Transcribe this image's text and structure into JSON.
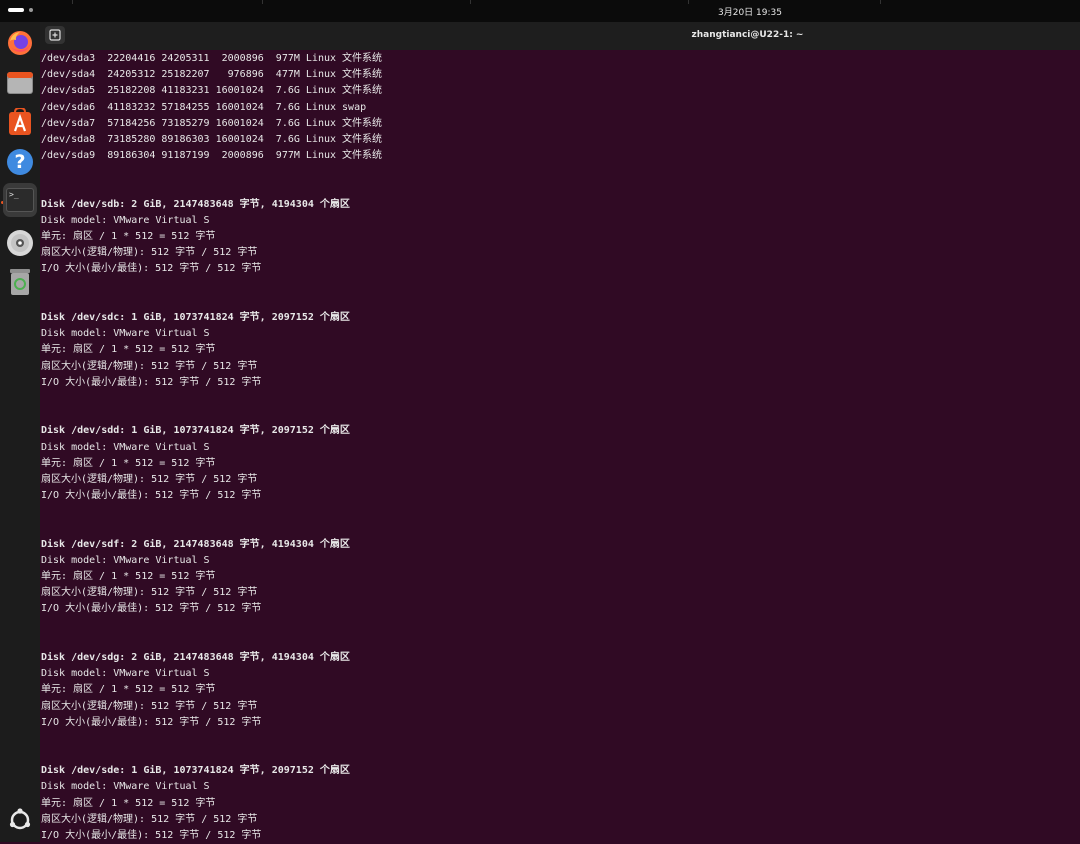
{
  "topbar": {
    "clock": "3月20日 19:35"
  },
  "dock": {
    "items": [
      {
        "name": "firefox-icon"
      },
      {
        "name": "files-icon"
      },
      {
        "name": "app-center-icon"
      },
      {
        "name": "help-icon"
      },
      {
        "name": "terminal-icon"
      },
      {
        "name": "disc-icon"
      },
      {
        "name": "trash-icon"
      },
      {
        "name": "show-apps-icon"
      }
    ],
    "terminal_glyph": ">_",
    "help_glyph": "?"
  },
  "terminal": {
    "title": "zhangtianci@U22-1: ~",
    "lines": [
      {
        "text": "/dev/sda3  22204416 24205311  2000896  977M Linux 文件系统",
        "bold": false
      },
      {
        "text": "/dev/sda4  24205312 25182207   976896  477M Linux 文件系统",
        "bold": false
      },
      {
        "text": "/dev/sda5  25182208 41183231 16001024  7.6G Linux 文件系统",
        "bold": false
      },
      {
        "text": "/dev/sda6  41183232 57184255 16001024  7.6G Linux swap",
        "bold": false
      },
      {
        "text": "/dev/sda7  57184256 73185279 16001024  7.6G Linux 文件系统",
        "bold": false
      },
      {
        "text": "/dev/sda8  73185280 89186303 16001024  7.6G Linux 文件系统",
        "bold": false
      },
      {
        "text": "/dev/sda9  89186304 91187199  2000896  977M Linux 文件系统",
        "bold": false
      },
      {
        "text": "",
        "bold": false
      },
      {
        "text": "",
        "bold": false
      },
      {
        "text": "Disk /dev/sdb: 2 GiB, 2147483648 字节, 4194304 个扇区",
        "bold": true
      },
      {
        "text": "Disk model: VMware Virtual S",
        "bold": false
      },
      {
        "text": "单元: 扇区 / 1 * 512 = 512 字节",
        "bold": false
      },
      {
        "text": "扇区大小(逻辑/物理): 512 字节 / 512 字节",
        "bold": false
      },
      {
        "text": "I/O 大小(最小/最佳): 512 字节 / 512 字节",
        "bold": false
      },
      {
        "text": "",
        "bold": false
      },
      {
        "text": "",
        "bold": false
      },
      {
        "text": "Disk /dev/sdc: 1 GiB, 1073741824 字节, 2097152 个扇区",
        "bold": true
      },
      {
        "text": "Disk model: VMware Virtual S",
        "bold": false
      },
      {
        "text": "单元: 扇区 / 1 * 512 = 512 字节",
        "bold": false
      },
      {
        "text": "扇区大小(逻辑/物理): 512 字节 / 512 字节",
        "bold": false
      },
      {
        "text": "I/O 大小(最小/最佳): 512 字节 / 512 字节",
        "bold": false
      },
      {
        "text": "",
        "bold": false
      },
      {
        "text": "",
        "bold": false
      },
      {
        "text": "Disk /dev/sdd: 1 GiB, 1073741824 字节, 2097152 个扇区",
        "bold": true
      },
      {
        "text": "Disk model: VMware Virtual S",
        "bold": false
      },
      {
        "text": "单元: 扇区 / 1 * 512 = 512 字节",
        "bold": false
      },
      {
        "text": "扇区大小(逻辑/物理): 512 字节 / 512 字节",
        "bold": false
      },
      {
        "text": "I/O 大小(最小/最佳): 512 字节 / 512 字节",
        "bold": false
      },
      {
        "text": "",
        "bold": false
      },
      {
        "text": "",
        "bold": false
      },
      {
        "text": "Disk /dev/sdf: 2 GiB, 2147483648 字节, 4194304 个扇区",
        "bold": true
      },
      {
        "text": "Disk model: VMware Virtual S",
        "bold": false
      },
      {
        "text": "单元: 扇区 / 1 * 512 = 512 字节",
        "bold": false
      },
      {
        "text": "扇区大小(逻辑/物理): 512 字节 / 512 字节",
        "bold": false
      },
      {
        "text": "I/O 大小(最小/最佳): 512 字节 / 512 字节",
        "bold": false
      },
      {
        "text": "",
        "bold": false
      },
      {
        "text": "",
        "bold": false
      },
      {
        "text": "Disk /dev/sdg: 2 GiB, 2147483648 字节, 4194304 个扇区",
        "bold": true
      },
      {
        "text": "Disk model: VMware Virtual S",
        "bold": false
      },
      {
        "text": "单元: 扇区 / 1 * 512 = 512 字节",
        "bold": false
      },
      {
        "text": "扇区大小(逻辑/物理): 512 字节 / 512 字节",
        "bold": false
      },
      {
        "text": "I/O 大小(最小/最佳): 512 字节 / 512 字节",
        "bold": false
      },
      {
        "text": "",
        "bold": false
      },
      {
        "text": "",
        "bold": false
      },
      {
        "text": "Disk /dev/sde: 1 GiB, 1073741824 字节, 2097152 个扇区",
        "bold": true
      },
      {
        "text": "Disk model: VMware Virtual S",
        "bold": false
      },
      {
        "text": "单元: 扇区 / 1 * 512 = 512 字节",
        "bold": false
      },
      {
        "text": "扇区大小(逻辑/物理): 512 字节 / 512 字节",
        "bold": false
      },
      {
        "text": "I/O 大小(最小/最佳): 512 字节 / 512 字节",
        "bold": false
      }
    ]
  },
  "colors": {
    "terminal_bg": "#300a24",
    "dock_bg": "#1c1c1c",
    "accent": "#e95420"
  }
}
